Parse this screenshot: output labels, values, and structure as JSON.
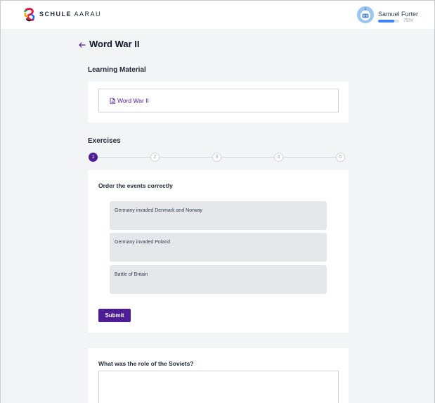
{
  "header": {
    "brand_strong": "SCHULE",
    "brand_light": "AARAU",
    "user_name": "Samuel Furter",
    "progress_value": 0.75,
    "progress_label": "75%"
  },
  "page": {
    "title": "Word War II"
  },
  "learning_material": {
    "heading": "Learning Material",
    "items": [
      {
        "label": "Word War II",
        "icon": "document-icon"
      }
    ]
  },
  "exercises": {
    "heading": "Exercises",
    "steps": [
      "1",
      "2",
      "3",
      "4",
      "5"
    ],
    "active_step": 1,
    "ordering": {
      "title": "Order the events correctly",
      "items": [
        "Germany invaded Denmark and Norway",
        "Germany invaded Poland",
        "Battle of Britain"
      ],
      "submit_label": "Submit"
    },
    "question": {
      "title": "What was the role of the Soviets?",
      "answer": ""
    }
  },
  "colors": {
    "accent": "#4c1d95",
    "progress": "#3b82f6",
    "background": "#f3f4f6"
  }
}
